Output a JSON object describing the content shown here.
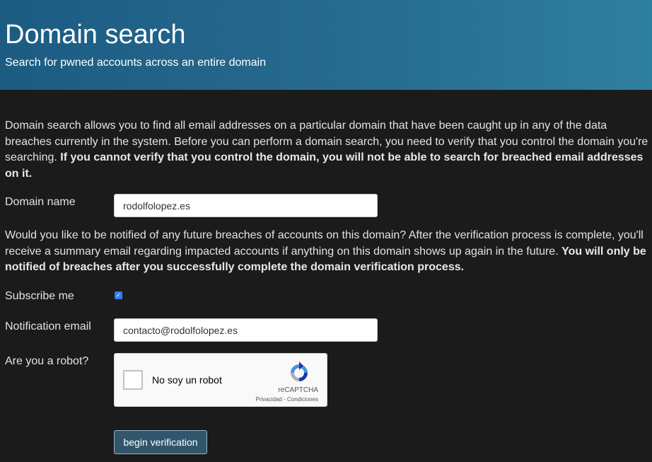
{
  "header": {
    "title": "Domain search",
    "subtitle": "Search for pwned accounts across an entire domain"
  },
  "intro": {
    "text": "Domain search allows you to find all email addresses on a particular domain that have been caught up in any of the data breaches currently in the system. Before you can perform a domain search, you need to verify that you control the domain you're searching. ",
    "bold": "If you cannot verify that you control the domain, you will not be able to search for breached email addresses on it."
  },
  "domain": {
    "label": "Domain name",
    "value": "rodolfolopez.es"
  },
  "notify": {
    "text": "Would you like to be notified of any future breaches of accounts on this domain? After the verification process is complete, you'll receive a summary email regarding impacted accounts if anything on this domain shows up again in the future. ",
    "bold": "You will only be notified of breaches after you successfully complete the domain verification process."
  },
  "subscribe": {
    "label": "Subscribe me",
    "checked": true
  },
  "notification_email": {
    "label": "Notification email",
    "value": "contacto@rodolfolopez.es"
  },
  "robot": {
    "label": "Are you a robot?",
    "captcha_label": "No soy un robot",
    "captcha_brand": "reCAPTCHA",
    "captcha_terms": "Privacidad - Condiciones"
  },
  "submit_label": "begin verification",
  "colors": {
    "header_start": "#1c5c82",
    "header_end": "#2e7fa0",
    "background": "#1b1b1b",
    "button": "#31566c",
    "checkbox": "#2f80ed"
  }
}
